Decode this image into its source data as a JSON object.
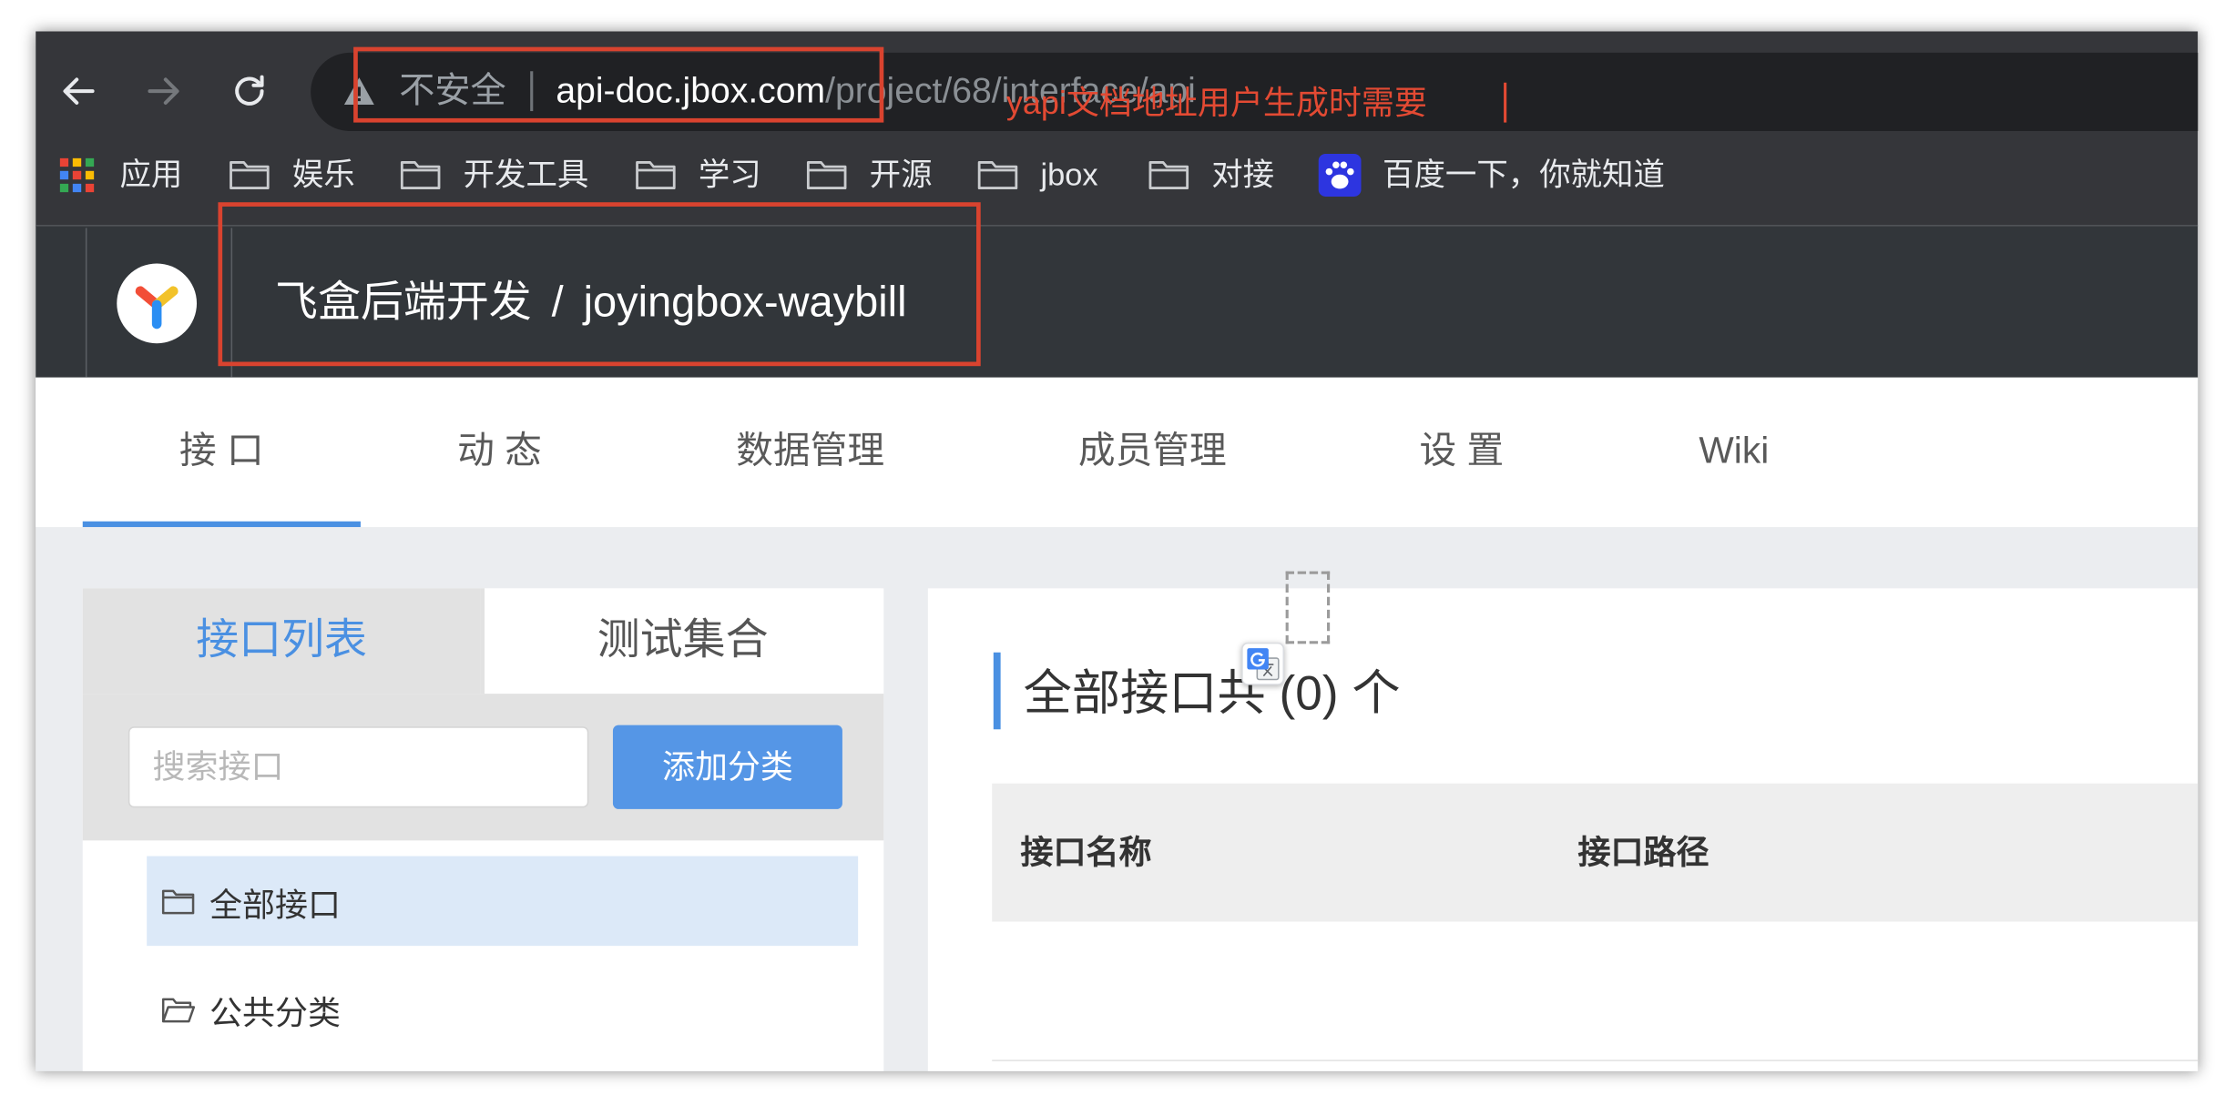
{
  "browser": {
    "toolbar": {
      "back_icon": "arrow-left-icon",
      "forward_icon": "arrow-right-icon",
      "reload_icon": "reload-icon"
    },
    "address_bar": {
      "security_icon": "warning-triangle-icon",
      "security_label": "不安全",
      "host": "api-doc.jbox.com",
      "path": "/project/68/interface/api"
    },
    "bookmarks": [
      {
        "label": "应用",
        "icon": "apps-grid-icon"
      },
      {
        "label": "娱乐",
        "icon": "folder-icon"
      },
      {
        "label": "开发工具",
        "icon": "folder-icon"
      },
      {
        "label": "学习",
        "icon": "folder-icon"
      },
      {
        "label": "开源",
        "icon": "folder-icon"
      },
      {
        "label": "jbox",
        "icon": "folder-icon"
      },
      {
        "label": "对接",
        "icon": "folder-icon"
      },
      {
        "label": "百度一下，你就知道",
        "icon": "baidu-icon"
      }
    ]
  },
  "annotation": {
    "text": "yapi文档地址用户生成时需要"
  },
  "header": {
    "logo_icon": "yapi-logo-icon",
    "breadcrumb": {
      "group": "飞盒后端开发",
      "separator": "/",
      "project": "joyingbox-waybill"
    }
  },
  "project_tabs": [
    {
      "label": "接 口",
      "active": true
    },
    {
      "label": "动 态",
      "active": false
    },
    {
      "label": "数据管理",
      "active": false
    },
    {
      "label": "成员管理",
      "active": false
    },
    {
      "label": "设 置",
      "active": false
    },
    {
      "label": "Wiki",
      "active": false
    }
  ],
  "sidebar": {
    "tabs": [
      {
        "label": "接口列表",
        "active": true
      },
      {
        "label": "测试集合",
        "active": false
      }
    ],
    "search": {
      "placeholder": "搜索接口",
      "value": ""
    },
    "add_category_button": "添加分类",
    "categories": [
      {
        "label": "全部接口",
        "icon": "folder-icon",
        "selected": true
      },
      {
        "label": "公共分类",
        "icon": "folder-open-icon",
        "selected": false
      }
    ]
  },
  "main": {
    "title": "全部接口共 (0) 个",
    "table": {
      "columns": [
        "接口名称",
        "接口路径"
      ],
      "rows": []
    }
  },
  "extension_icon": "google-translate-icon",
  "colors": {
    "accent": "#4a90e2",
    "annotation": "#e34a33",
    "browser_toolbar": "#35363a",
    "address_bar": "#202124",
    "page_header": "#32363a",
    "selected_row": "#dce9f8"
  }
}
